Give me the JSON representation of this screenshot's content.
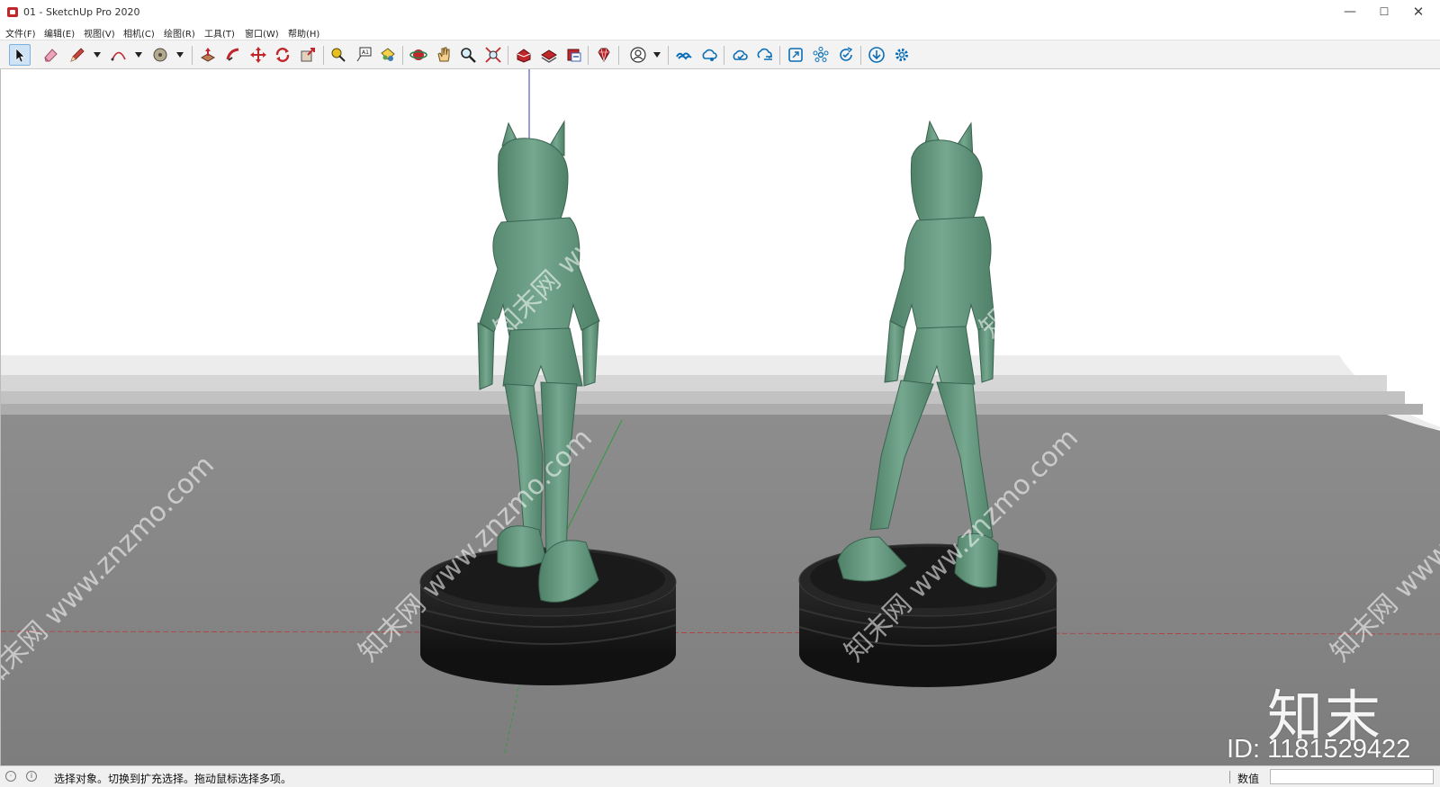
{
  "window": {
    "title": "01 - SketchUp Pro 2020",
    "minimize_symbol": "—",
    "maximize_symbol": "☐",
    "close_symbol": "✕"
  },
  "menu": [
    {
      "label": "文件(F)"
    },
    {
      "label": "编辑(E)"
    },
    {
      "label": "视图(V)"
    },
    {
      "label": "相机(C)"
    },
    {
      "label": "绘图(R)"
    },
    {
      "label": "工具(T)"
    },
    {
      "label": "窗口(W)"
    },
    {
      "label": "帮助(H)"
    }
  ],
  "toolbar": {
    "active_tool": "select-tool",
    "tools": [
      "select-icon",
      "eraser-icon",
      "pencil-line-icon",
      "arc-icon",
      "paint-bucket-icon",
      "push-pull-icon",
      "follow-me-icon",
      "move-icon",
      "rotate-icon",
      "scale-icon",
      "tape-measure-icon",
      "text-icon",
      "paint-icon",
      "orbit-icon",
      "pan-icon",
      "zoom-icon",
      "zoom-extents-icon",
      "warehouse-icon",
      "extension-warehouse-icon",
      "layout-icon",
      "ruby-icon",
      "user-account-icon",
      "trimble-connect-icon",
      "cloud-share-icon",
      "cloud-check-icon",
      "cloud-sync-icon",
      "frame-icon",
      "component-icon",
      "refresh-check-icon",
      "download-icon",
      "settings-icon"
    ]
  },
  "viewport": {
    "sky_color": "#ffffff",
    "ground_color": "#8c8c8c",
    "model_color": "#6b9e86",
    "base_color": "#1d1d1d",
    "watermark_text": "知末网 www.znzmo.com"
  },
  "brand": {
    "logo_text": "知末",
    "id_text": "ID: 1181529422"
  },
  "status": {
    "message": "选择对象。切换到扩充选择。拖动鼠标选择多项。",
    "measurement_label": "数值",
    "measurement_value": ""
  }
}
